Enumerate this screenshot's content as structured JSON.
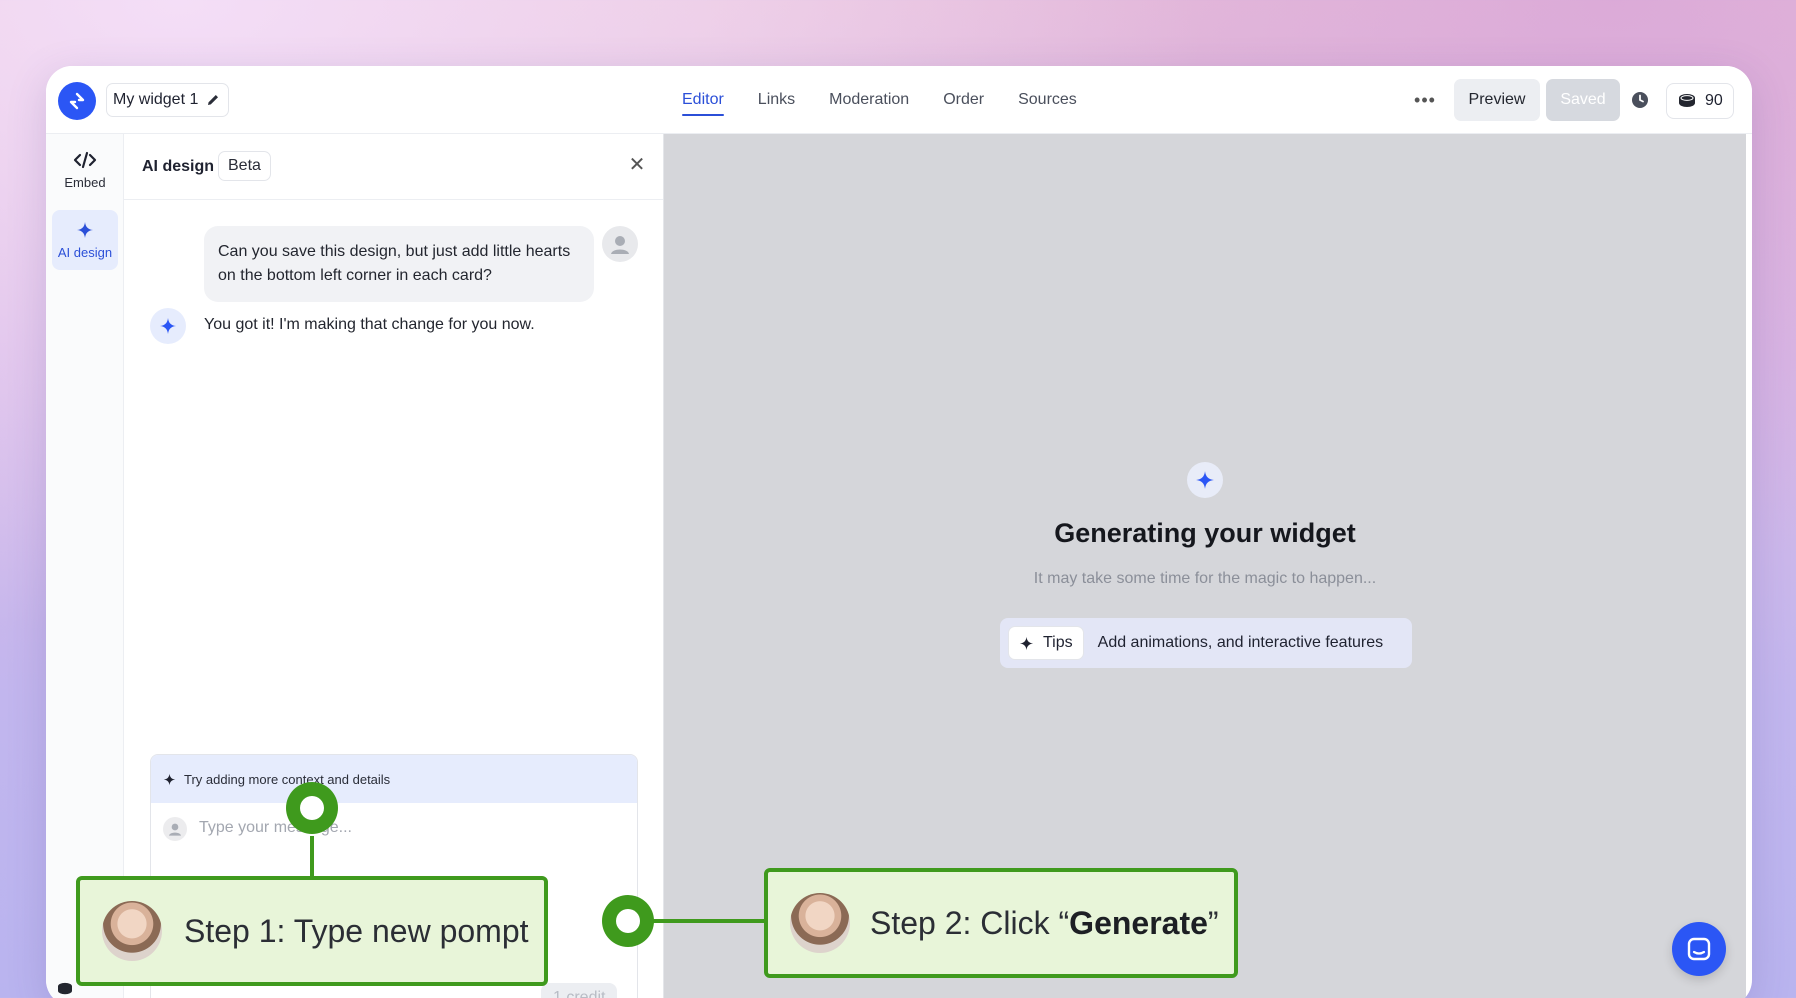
{
  "app": {
    "widget_name": "My widget 1",
    "accent_color": "#2b56f5"
  },
  "header": {
    "tabs": [
      {
        "label": "Editor",
        "active": true
      },
      {
        "label": "Links",
        "active": false
      },
      {
        "label": "Moderation",
        "active": false
      },
      {
        "label": "Order",
        "active": false
      },
      {
        "label": "Sources",
        "active": false
      }
    ],
    "more_icon": "ellipsis-icon",
    "preview_label": "Preview",
    "saved_label": "Saved",
    "history_icon": "clock-icon",
    "credits_icon": "coin-stack-icon",
    "credits_count": "90"
  },
  "rail": {
    "items": [
      {
        "label": "Embed",
        "icon": "code-icon",
        "active": false
      },
      {
        "label": "AI design",
        "icon": "sparkle-icon",
        "active": true
      }
    ]
  },
  "panel": {
    "title": "AI design",
    "badge": "Beta",
    "close_icon": "close-icon",
    "messages": [
      {
        "role": "user",
        "text": "Can you save this design, but just add little hearts on the bottom left corner in each card?"
      },
      {
        "role": "assistant",
        "text": "You got it! I'm making that change for you now."
      }
    ],
    "composer": {
      "hint": "Try adding more context and details",
      "placeholder": "Type your message...",
      "value": "",
      "credit_label": "1 credit"
    }
  },
  "preview": {
    "title": "Generating your widget",
    "subtitle": "It may take some time for the magic to happen...",
    "tips_button": "Tips",
    "tips_text": "Add animations, and interactive features"
  },
  "overlays": {
    "step1": "Step 1: Type new pompt",
    "step2_prefix": "Step 2: Click “",
    "step2_bold": "Generate",
    "step2_suffix": "”",
    "color": "#3f9a1d"
  }
}
